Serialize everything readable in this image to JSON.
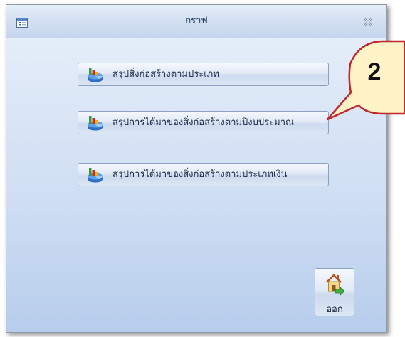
{
  "window": {
    "title": "กราฟ",
    "title_icon": "form-window-icon",
    "close_icon": "close-x-icon"
  },
  "menu": {
    "items": [
      {
        "label": "สรุปสิ่งก่อสร้างตามประเภท",
        "icon": "chart-3d-icon"
      },
      {
        "label": "สรุปการได้มาของสิ่งก่อสร้างตามปีงบประมาณ",
        "icon": "chart-3d-icon"
      },
      {
        "label": "สรุปการได้มาของสิ่งก่อสร้างตามประเภทเงิน",
        "icon": "chart-3d-icon"
      }
    ]
  },
  "exit": {
    "label": "ออก",
    "icon": "home-exit-icon"
  },
  "annotation": {
    "number": "2",
    "border_color": "#c0262a",
    "fill_color": "#fff3c7"
  }
}
